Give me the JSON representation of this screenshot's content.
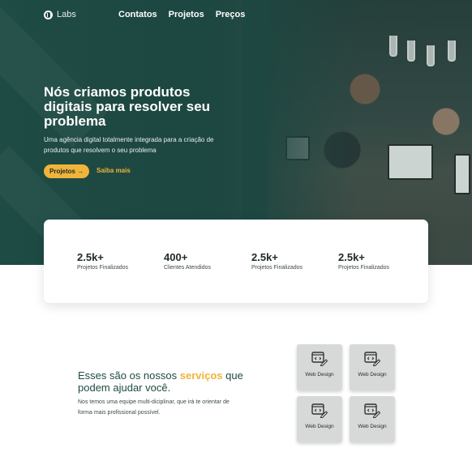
{
  "header": {
    "logo_text": "Labs",
    "nav": [
      "Contatos",
      "Projetos",
      "Preços"
    ]
  },
  "hero": {
    "headline": "Nós criamos produtos digitais para resolver seu problema",
    "subtext": "Uma agência digital totalmente integrada para a criação de produtos que resolvem o seu problema",
    "primary_button": "Projetos →",
    "secondary_button": "Saiba mais"
  },
  "stats": [
    {
      "value": "2.5k+",
      "label": "Projetos Finalizados"
    },
    {
      "value": "400+",
      "label": "Clientes Atendidos"
    },
    {
      "value": "2.5k+",
      "label": "Projetos Finalizados"
    },
    {
      "value": "2.5k+",
      "label": "Projetos Finalizados"
    }
  ],
  "services": {
    "title_before": "Esses são os nossos ",
    "title_highlight": "serviços",
    "title_after": " que podem ajudar você.",
    "description": "Nos temos uma equipe multi-diciplinar, que irá te orientar de forma mais profissional possível.",
    "tiles": [
      {
        "label": "Web Design",
        "icon": "web-design-icon"
      },
      {
        "label": "Web Design",
        "icon": "web-design-icon"
      },
      {
        "label": "Web Design",
        "icon": "web-design-icon"
      },
      {
        "label": "Web Design",
        "icon": "web-design-icon"
      }
    ]
  },
  "colors": {
    "hero_bg": "#1d4741",
    "accent": "#f0b43a",
    "heading": "#1e4b44"
  }
}
